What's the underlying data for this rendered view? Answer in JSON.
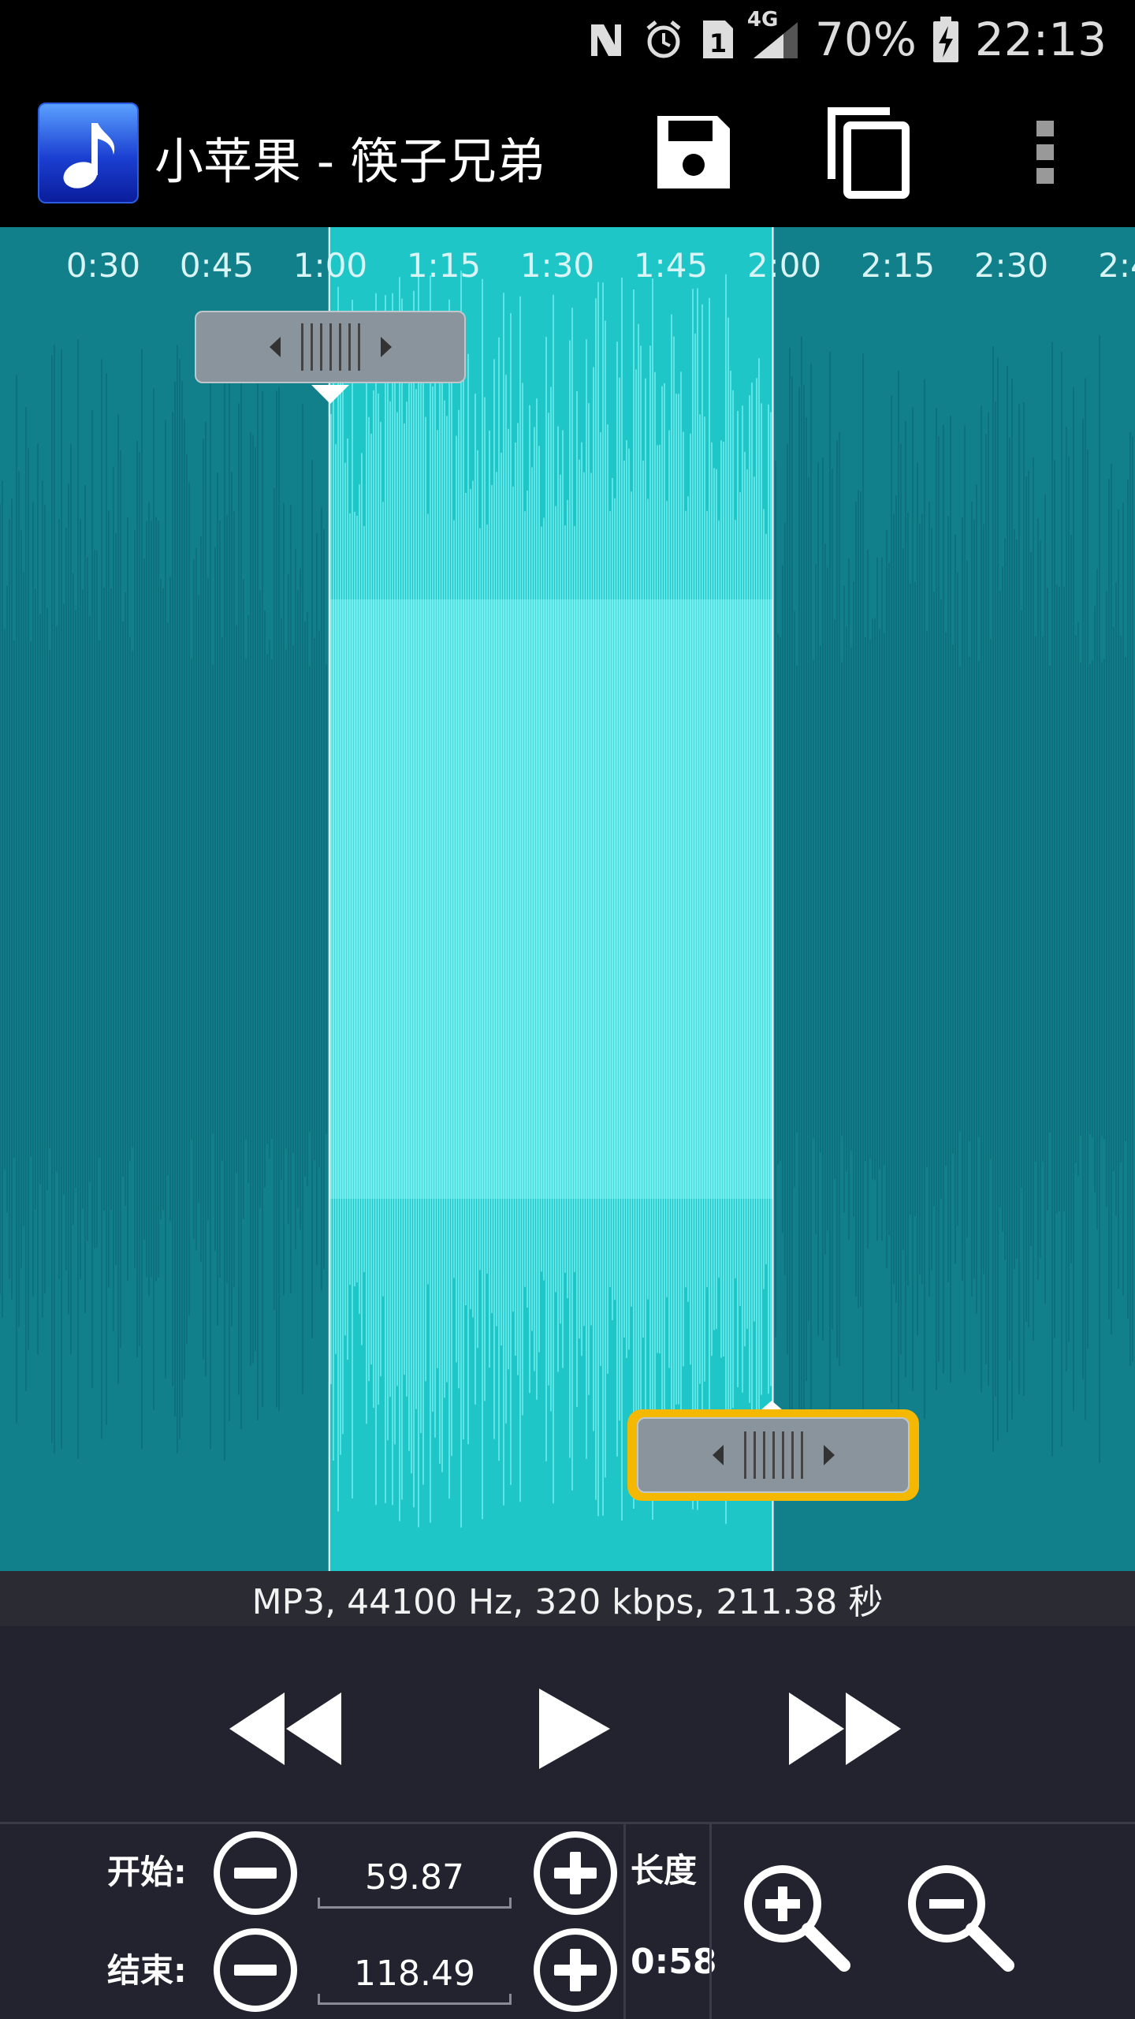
{
  "status_bar": {
    "battery_percent": "70%",
    "time": "22:13",
    "network": "4G",
    "sim_slot": "1",
    "icons": [
      "nfc-icon",
      "alarm-icon",
      "sim-icon",
      "signal-icon",
      "battery-charging-icon"
    ]
  },
  "action_bar": {
    "title": "小苹果 - 筷子兄弟",
    "app_icon": "music-note-icon",
    "actions": [
      "save-icon",
      "copy-icon",
      "overflow-menu-icon"
    ]
  },
  "timeline": {
    "ticks": [
      "0:30",
      "0:45",
      "1:00",
      "1:15",
      "1:30",
      "1:45",
      "2:00",
      "2:15",
      "2:30",
      "2:4"
    ],
    "selection_start_seconds": 59.87,
    "selection_end_seconds": 118.49,
    "playhead_seconds": 118.49
  },
  "colors": {
    "waveform_unselected": "#12808a",
    "waveform_selected": "#1fc6c8",
    "waveform_peak_selected": "#98ffff",
    "accent": "#33b5e5",
    "end_handle_highlight": "#f5b800",
    "controls_bg": "#23232f"
  },
  "info": {
    "text": "MP3, 44100 Hz, 320 kbps, 211.38 秒"
  },
  "transport": {
    "buttons": [
      "rewind-icon",
      "play-icon",
      "fast-forward-icon"
    ]
  },
  "editor": {
    "start_label": "开始:",
    "end_label": "结束:",
    "start_value": "59.87",
    "end_value": "118.49",
    "length_label": "长度",
    "length_value": "0:58",
    "zoom": [
      "zoom-in-icon",
      "zoom-out-icon"
    ]
  }
}
